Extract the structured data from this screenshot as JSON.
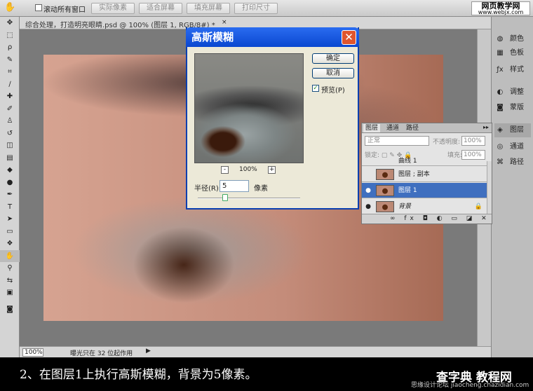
{
  "options_bar": {
    "tool_icon": "hand-icon",
    "scroll_all_label": "滚动所有窗口",
    "buttons": [
      "实际像素",
      "适合屏幕",
      "填充屏幕",
      "打印尺寸"
    ]
  },
  "brand": {
    "title": "网页教学网",
    "url": "www.webjx.com"
  },
  "document": {
    "tab_title": "综合处理，打造明亮眼睛.psd @ 100% (图层 1, RGB/8#) *",
    "close": "×"
  },
  "status": {
    "zoom": "100%",
    "text": "曝光只在 32 位起作用",
    "arrow": "▶"
  },
  "dock": [
    {
      "icon": "color-icon",
      "label": "颜色"
    },
    {
      "icon": "swatches-icon",
      "label": "色板"
    },
    {
      "icon": "styles-icon",
      "label": "样式"
    },
    {
      "icon": "adjustments-icon",
      "label": "调整"
    },
    {
      "icon": "masks-icon",
      "label": "蒙版"
    },
    {
      "icon": "layers-icon",
      "label": "图层"
    },
    {
      "icon": "channels-icon",
      "label": "通道"
    },
    {
      "icon": "paths-icon",
      "label": "路径"
    }
  ],
  "layers_panel": {
    "tabs": [
      "图层",
      "通道",
      "路径"
    ],
    "collapse": "▸▸",
    "blend_mode": "正常",
    "opacity_label": "不透明度:",
    "opacity": "100%",
    "lock_label": "锁定:",
    "fill_label": "填充:",
    "fill": "100%",
    "layers": [
      {
        "name": "曲线 1",
        "eye": ""
      },
      {
        "name": "图层 ; 副本",
        "eye": ""
      },
      {
        "name": "图层 1",
        "eye": "●"
      },
      {
        "name": "背景",
        "eye": "●",
        "lock": "🔒"
      }
    ],
    "footer_icons": "∞ fx ◘ ◐ ▭ ◪ ✕"
  },
  "dialog": {
    "title": "高斯模糊",
    "close": "✕",
    "ok": "确定",
    "cancel": "取消",
    "preview_label": "预览(P)",
    "preview_checked": "✓",
    "zoom": "100%",
    "zoom_minus": "-",
    "zoom_plus": "+",
    "radius_label": "半径(R):",
    "radius_value": "5",
    "radius_unit": "像素",
    "slider_level": 0.27
  },
  "caption": "2、在图层1上执行高斯模糊，背景为5像素。",
  "watermark": {
    "logo": "查字典 教程网",
    "url": "jiaocheng.chazidian.com",
    "prefix": "思缘设计论坛"
  }
}
